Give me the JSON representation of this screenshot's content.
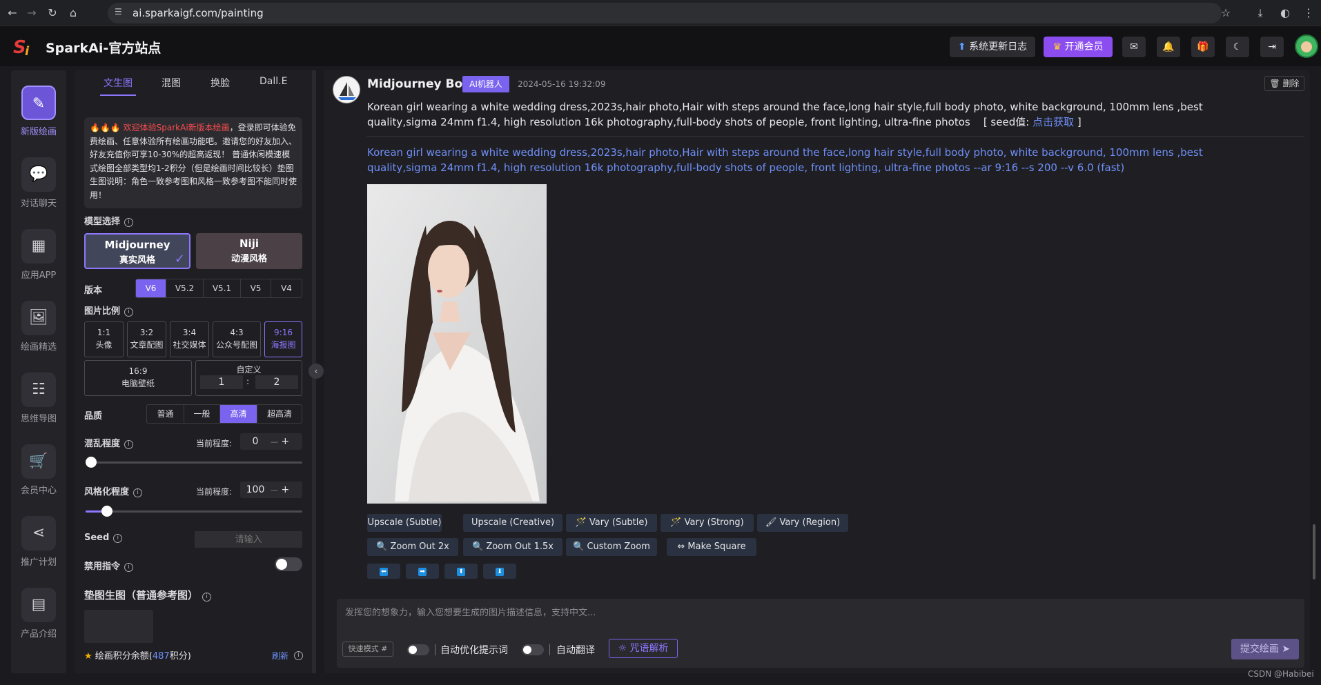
{
  "browser": {
    "url": "ai.sparkaigf.com/painting",
    "nav_icons": [
      "back-icon",
      "forward-icon",
      "reload-icon",
      "home-icon"
    ]
  },
  "header": {
    "brand": "SparkAi-官方站点",
    "changelog_label": "系统更新日志",
    "vip_label": "开通会员"
  },
  "rail": {
    "items": [
      {
        "label": "新版绘画",
        "icon": "✎"
      },
      {
        "label": "对话聊天",
        "icon": "💬"
      },
      {
        "label": "应用APP",
        "icon": "▦"
      },
      {
        "label": "绘画精选",
        "icon": "🖼"
      },
      {
        "label": "思维导图",
        "icon": "☷"
      },
      {
        "label": "会员中心",
        "icon": "🛒"
      },
      {
        "label": "推广计划",
        "icon": "⋖"
      },
      {
        "label": "产品介绍",
        "icon": "▤"
      }
    ]
  },
  "panel": {
    "tabs": [
      "文生图",
      "混图",
      "换脸",
      "Dall.E"
    ],
    "notice_prefix": "🔥🔥🔥 ",
    "notice_red": "欢迎体验SparkAi新版本绘画",
    "notice_body": "，登录即可体验免费绘画、任意体验所有绘画功能吧。邀请您的好友加入、好友充值你可享10-30%的超高返现！ 普通休闲模速模式绘图全部类型均1-2积分（但是绘画时间比较长）垫图生图说明：角色一致参考图和风格一致参考图不能同时使用！",
    "model_label": "模型选择",
    "models": [
      {
        "name": "Midjourney",
        "style": "真实风格"
      },
      {
        "name": "Niji",
        "style": "动漫风格"
      }
    ],
    "version_label": "版本",
    "versions": [
      "V6",
      "V5.2",
      "V5.1",
      "V5",
      "V4"
    ],
    "ratio_label": "图片比例",
    "ratios": [
      {
        "ratio": "1:1",
        "name": "头像"
      },
      {
        "ratio": "3:2",
        "name": "文章配图"
      },
      {
        "ratio": "3:4",
        "name": "社交媒体"
      },
      {
        "ratio": "4:3",
        "name": "公众号配图"
      },
      {
        "ratio": "9:16",
        "name": "海报图"
      },
      {
        "ratio": "16:9",
        "name": "电脑壁纸"
      }
    ],
    "custom_label": "自定义",
    "custom_w": "1",
    "custom_colon": ":",
    "custom_h": "2",
    "quality_label": "品质",
    "qualities": [
      "普通",
      "一般",
      "高清",
      "超高清"
    ],
    "chaos_label": "混乱程度",
    "current_label": "当前程度:",
    "chaos_value": "0",
    "chaos_fraction": 0,
    "stylize_label": "风格化程度",
    "stylize_value": "100",
    "stylize_fraction": 0.1,
    "minus": "—",
    "plus": "+",
    "seed_label": "Seed",
    "seed_placeholder": "请输入",
    "no_label": "禁用指令",
    "ref_label": "垫图生图（普通参考图）",
    "credit_prefix": "绘画积分余额(",
    "credit_value": "487",
    "credit_suffix": "积分)",
    "refresh_label": "刷新"
  },
  "message": {
    "bot_name": "Midjourney Bot",
    "badge": "AI机器人",
    "time": "2024-05-16 19:32:09",
    "delete_label": "删除",
    "prompt": "Korean girl wearing a white wedding dress,2023s,hair photo,Hair with steps around the face,long hair style,full body photo, white background, 100mm lens ,best quality,sigma 24mm f1.4, high resolution 16k photography,full-body shots of people, front lighting, ultra-fine photos",
    "seed_prefix": "[ seed值: ",
    "seed_link": "点击获取",
    "seed_suffix": " ]",
    "full_prompt": "Korean girl wearing a white wedding dress,2023s,hair photo,Hair with steps around the face,long hair style,full body photo, white background, 100mm lens ,best quality,sigma 24mm f1.4, high resolution 16k photography,full-body shots of people, front lighting, ultra-fine photos --ar 9:16 --s 200 --v 6.0  (fast)",
    "actions_row1": [
      "Upscale (Subtle)",
      "Upscale (Creative)",
      "🪄 Vary (Subtle)",
      "🪄 Vary (Strong)",
      "🖌 Vary (Region)"
    ],
    "actions_row2": [
      "🔍 Zoom Out 2x",
      "🔍 Zoom Out 1.5x",
      "🔍 Custom Zoom",
      "⇔ Make Square"
    ],
    "arrows": [
      "⬅",
      "➡",
      "⬆",
      "⬇"
    ]
  },
  "composer": {
    "placeholder": "发挥您的想象力，输入您想要生成的图片描述信息，支持中文...",
    "mode_label": "快速模式 #",
    "opt1": "自动优化提示词",
    "opt2": "自动翻译",
    "parse_label": "咒语解析",
    "submit_label": "提交绘画"
  },
  "watermark": "CSDN @Habibei",
  "colors": {
    "accent": "#7a63ee",
    "link": "#6f8ff7",
    "vip": "#8b4cf0"
  }
}
